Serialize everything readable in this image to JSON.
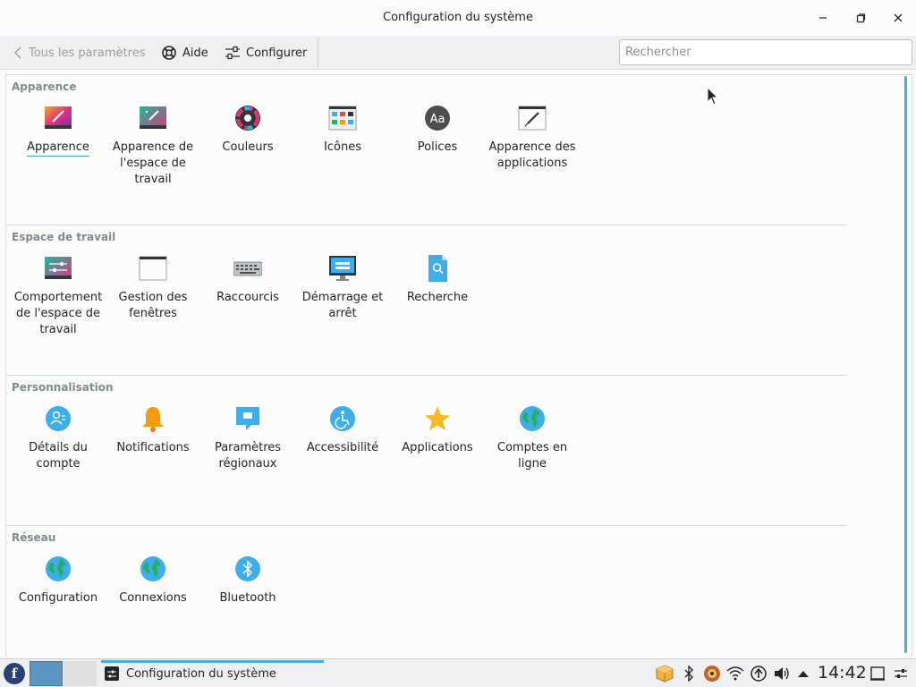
{
  "window": {
    "title": "Configuration du système"
  },
  "toolbar": {
    "back_label": "Tous les paramètres",
    "help_label": "Aide",
    "configure_label": "Configurer",
    "search_placeholder": "Rechercher",
    "search_value": ""
  },
  "sections": [
    {
      "title": "Apparence",
      "items": [
        {
          "label": "Apparence",
          "icon": "appearance-icon",
          "active": true
        },
        {
          "label": "Apparence de l'espace de travail",
          "icon": "workspace-theme-icon"
        },
        {
          "label": "Couleurs",
          "icon": "colors-icon"
        },
        {
          "label": "Icônes",
          "icon": "icons-icon"
        },
        {
          "label": "Polices",
          "icon": "fonts-icon"
        },
        {
          "label": "Apparence des applications",
          "icon": "app-style-icon"
        }
      ]
    },
    {
      "title": "Espace de travail",
      "items": [
        {
          "label": "Comportement de l'espace de travail",
          "icon": "workspace-behavior-icon"
        },
        {
          "label": "Gestion des fenêtres",
          "icon": "window-management-icon"
        },
        {
          "label": "Raccourcis",
          "icon": "keyboard-icon"
        },
        {
          "label": "Démarrage et arrêt",
          "icon": "startup-shutdown-icon"
        },
        {
          "label": "Recherche",
          "icon": "search-file-icon"
        }
      ]
    },
    {
      "title": "Personnalisation",
      "items": [
        {
          "label": "Détails du compte",
          "icon": "account-icon"
        },
        {
          "label": "Notifications",
          "icon": "bell-icon"
        },
        {
          "label": "Paramètres régionaux",
          "icon": "regional-icon"
        },
        {
          "label": "Accessibilité",
          "icon": "accessibility-icon"
        },
        {
          "label": "Applications",
          "icon": "star-icon"
        },
        {
          "label": "Comptes en ligne",
          "icon": "globe-icon"
        }
      ]
    },
    {
      "title": "Réseau",
      "items": [
        {
          "label": "Configuration",
          "icon": "globe-icon"
        },
        {
          "label": "Connexions",
          "icon": "globe-icon"
        },
        {
          "label": "Bluetooth",
          "icon": "bluetooth-icon"
        }
      ]
    }
  ],
  "taskbar": {
    "launcher_glyph": "f",
    "task_label": "Configuration du système",
    "clock": "14:42"
  },
  "colors": {
    "accent": "#3daee9",
    "text": "#232627",
    "section_title": "#7f8c8d"
  }
}
